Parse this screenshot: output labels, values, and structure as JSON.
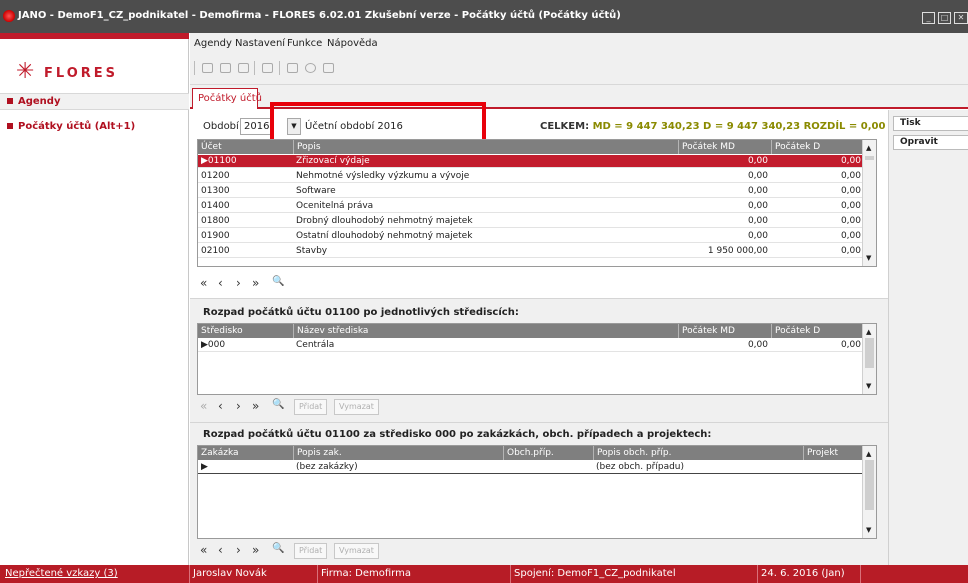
{
  "window": {
    "title": "JANO - DemoF1_CZ_podnikatel - Demofirma - FLORES 6.02.01 Zkušební verze - Počátky účtů  (Počátky účtů)"
  },
  "sidebar": {
    "logo_text": "FLORES",
    "agendy_label": "Agendy",
    "items": [
      {
        "label": "Počátky účtů (Alt+1)"
      }
    ]
  },
  "menu": [
    "Agendy",
    "Nastavení",
    "Funkce",
    "Nápověda"
  ],
  "tab": {
    "label": "Počátky účtů"
  },
  "filter": {
    "period_label": "Období :",
    "year": "2016",
    "period_name": "Účetní období 2016"
  },
  "totals": {
    "label": "CELKEM:",
    "md_label": "MD =",
    "md_value": "9 447 340,23",
    "d_label": "D =",
    "d_value": "9 447 340,23",
    "diff_label": "ROZDÍL =",
    "diff_value": "0,00"
  },
  "accounts_grid": {
    "columns": [
      "Účet",
      "Popis",
      "Počátek MD",
      "Počátek D"
    ],
    "rows": [
      {
        "ucet": "01100",
        "popis": "Zřizovací výdaje",
        "md": "0,00",
        "d": "0,00"
      },
      {
        "ucet": "01200",
        "popis": "Nehmotné výsledky výzkumu a vývoje",
        "md": "0,00",
        "d": "0,00"
      },
      {
        "ucet": "01300",
        "popis": "Software",
        "md": "0,00",
        "d": "0,00"
      },
      {
        "ucet": "01400",
        "popis": "Ocenitelná práva",
        "md": "0,00",
        "d": "0,00"
      },
      {
        "ucet": "01800",
        "popis": "Drobný dlouhodobý nehmotný majetek",
        "md": "0,00",
        "d": "0,00"
      },
      {
        "ucet": "01900",
        "popis": "Ostatní dlouhodobý nehmotný majetek",
        "md": "0,00",
        "d": "0,00"
      },
      {
        "ucet": "02100",
        "popis": "Stavby",
        "md": "1 950 000,00",
        "d": "0,00"
      }
    ]
  },
  "nav_symbols": {
    "first": "«",
    "prev": "‹",
    "next": "›",
    "last": "»",
    "search": "🔍"
  },
  "section2": {
    "title": "Rozpad počátků účtu 01100 po jednotlivých střediscích:",
    "columns": [
      "Středisko",
      "Název střediska",
      "Počátek MD",
      "Počátek D"
    ],
    "rows": [
      {
        "stredisko": "000",
        "nazev": "Centrála",
        "md": "0,00",
        "d": "0,00"
      }
    ],
    "add_label": "Přidat",
    "delete_label": "Vymazat"
  },
  "section3": {
    "title": "Rozpad počátků účtu 01100 za středisko 000 po zakázkách, obch. případech a projektech:",
    "columns": [
      "Zakázka",
      "Popis zak.",
      "Obch.příp.",
      "Popis obch. příp.",
      "Projekt"
    ],
    "rows": [
      {
        "zakazka": "",
        "popis_zak": "(bez zakázky)",
        "obch": "",
        "popis_obch": "(bez obch. případu)",
        "projekt": ""
      }
    ],
    "add_label": "Přidat",
    "delete_label": "Vymazat"
  },
  "right_panel": {
    "print_label": "Tisk",
    "edit_label": "Opravit"
  },
  "statusbar": {
    "unread_reports": "Nepřečtené vzkazy (3)",
    "user": "Jaroslav Novák",
    "company": "Firma: Demofirma",
    "connection": "Spojení: DemoF1_CZ_podnikatel",
    "date": "24. 6. 2016 (Jan)"
  }
}
